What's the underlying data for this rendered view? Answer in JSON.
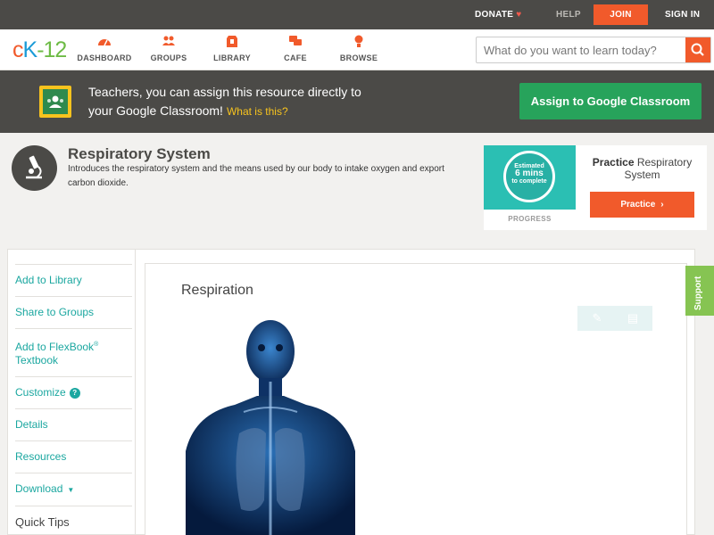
{
  "topbar": {
    "donate": "DONATE",
    "help": "HELP",
    "join": "JOIN",
    "signin": "SIGN IN"
  },
  "nav": {
    "logo": {
      "c": "c",
      "k": "K",
      "dash": "-",
      "num": "12"
    },
    "items": [
      {
        "label": "DASHBOARD",
        "icon": "dashboard-icon"
      },
      {
        "label": "GROUPS",
        "icon": "groups-icon"
      },
      {
        "label": "LIBRARY",
        "icon": "library-icon"
      },
      {
        "label": "CAFE",
        "icon": "cafe-icon"
      },
      {
        "label": "BROWSE",
        "icon": "browse-icon"
      }
    ],
    "search_placeholder": "What do you want to learn today?"
  },
  "banner": {
    "line1": "Teachers, you can assign this resource directly to",
    "line2": "your Google Classroom!",
    "what": "What is this?",
    "assign_label": "Assign to Google Classroom"
  },
  "header": {
    "title": "Respiratory System",
    "description": "Introduces the respiratory system and the means used by our body to intake oxygen and export carbon dioxide."
  },
  "practice_card": {
    "estimated": "Estimated",
    "mins": "6 mins",
    "to_complete": "to complete",
    "progress_label": "PROGRESS",
    "title_bold": "Practice",
    "title_rest": "Respiratory System",
    "button_label": "Practice"
  },
  "sidebar": {
    "add_library": "Add to Library",
    "share_groups": "Share to Groups",
    "add_flexbook_1": "Add to FlexBook",
    "reg": "®",
    "add_flexbook_2": "Textbook",
    "customize": "Customize",
    "details": "Details",
    "resources": "Resources",
    "download": "Download",
    "quick_tips": "Quick Tips"
  },
  "content": {
    "title": "Respiration"
  },
  "support": "Support",
  "colors": {
    "brand_orange": "#f15a2b",
    "teal": "#1ba7a0",
    "google_green": "#27a35b",
    "dark_bar": "#4b4a47",
    "support_green": "#86c452"
  }
}
